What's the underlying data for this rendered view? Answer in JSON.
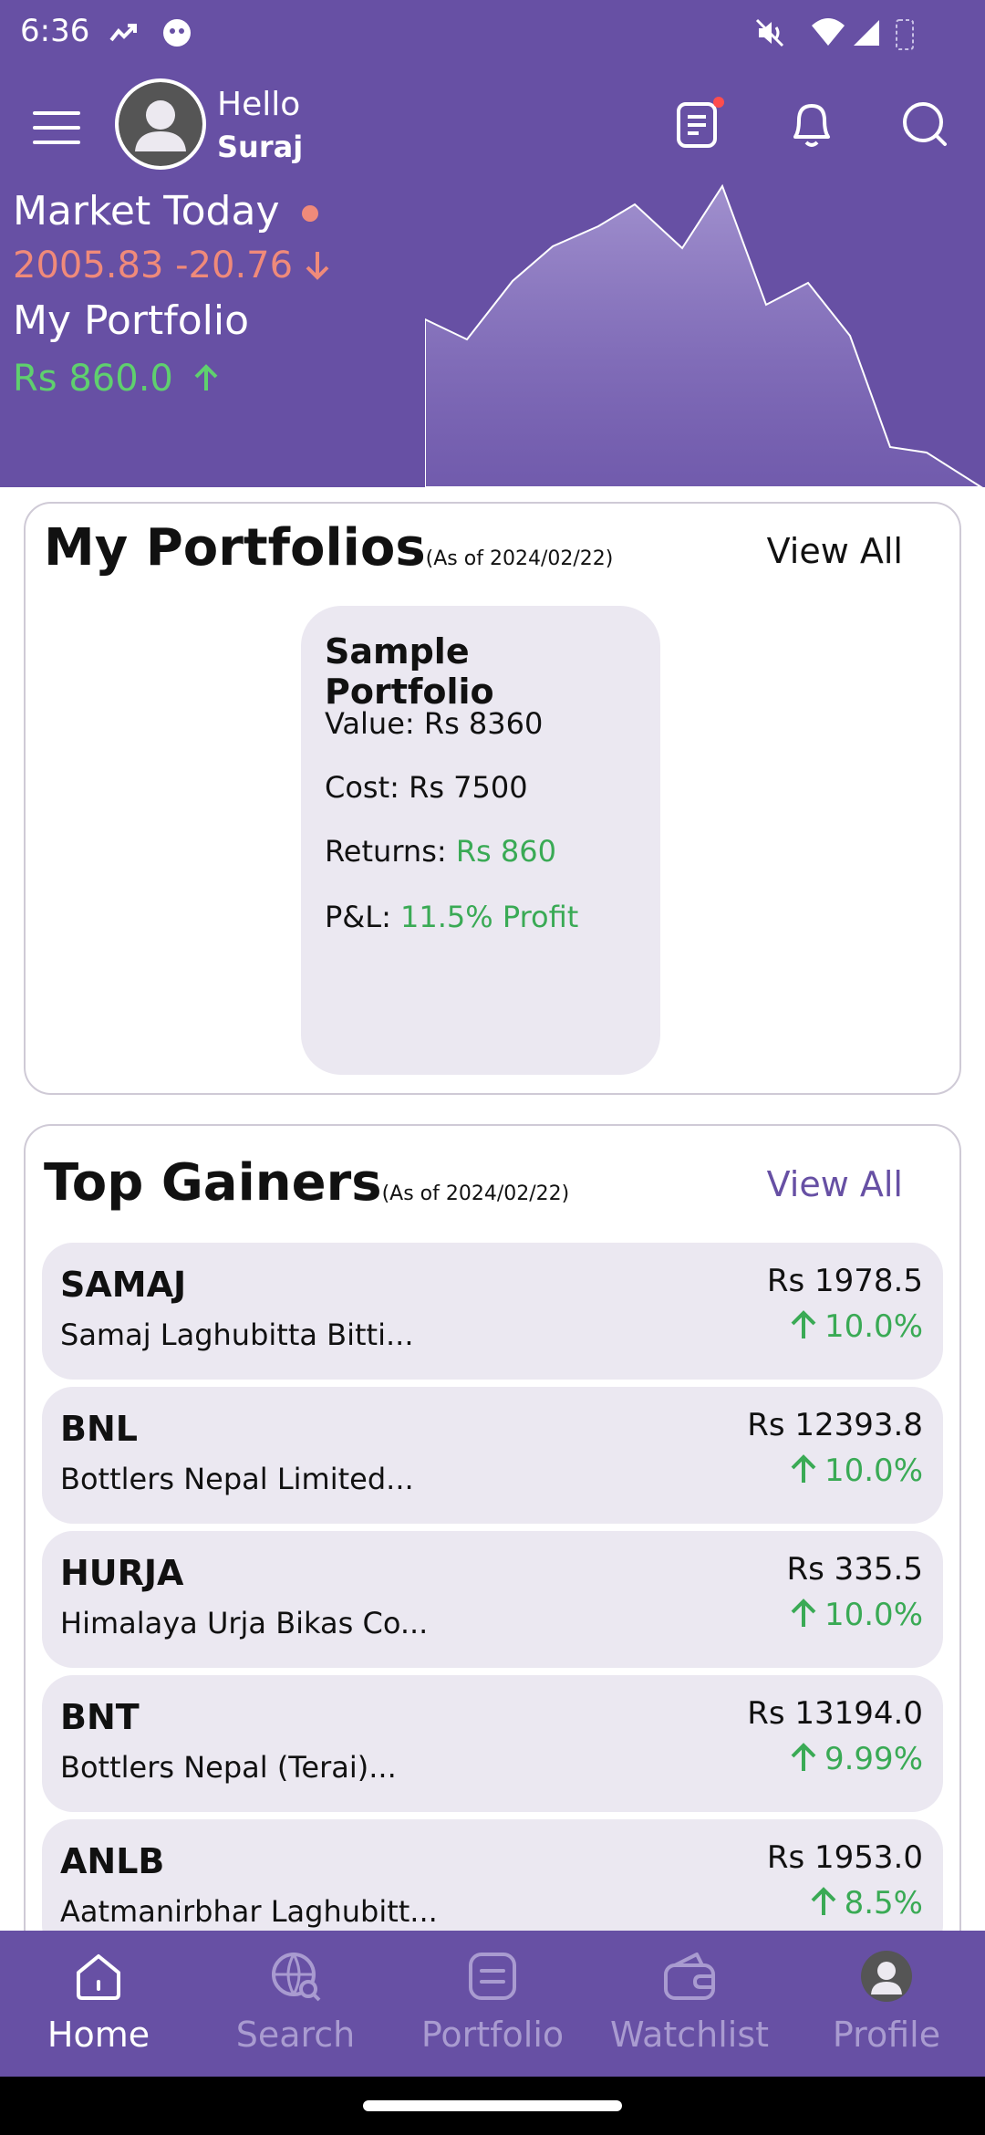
{
  "status": {
    "time": "6:36"
  },
  "user": {
    "greeting": "Hello",
    "name": "Suraj"
  },
  "market": {
    "title": "Market Today",
    "value_change": "2005.83 -20.76",
    "portfolio_label": "My Portfolio",
    "portfolio_value": "Rs 860.0"
  },
  "portfolios": {
    "title": "My Portfolios",
    "as_of": "(As of 2024/02/22)",
    "view_all": "View All",
    "card": {
      "name": "Sample Portfolio",
      "value_label": "Value:",
      "value": "Rs  8360",
      "cost_label": "Cost:",
      "cost": "Rs  7500",
      "returns_label": "Returns:",
      "returns": "Rs 860",
      "pl_label": "P&L:",
      "pl": "11.5% Profit"
    }
  },
  "gainers": {
    "title": "Top Gainers",
    "as_of": "(As of 2024/02/22)",
    "view_all": "View All",
    "items": [
      {
        "symbol": "SAMAJ",
        "name": "Samaj Laghubitta Bitti...",
        "price": "Rs 1978.5",
        "change": "10.0%"
      },
      {
        "symbol": "BNL",
        "name": "Bottlers Nepal Limited...",
        "price": "Rs 12393.8",
        "change": "10.0%"
      },
      {
        "symbol": "HURJA",
        "name": "Himalaya Urja Bikas Co...",
        "price": "Rs 335.5",
        "change": "10.0%"
      },
      {
        "symbol": "BNT",
        "name": "Bottlers Nepal (Terai)...",
        "price": "Rs 13194.0",
        "change": "9.99%"
      },
      {
        "symbol": "ANLB",
        "name": "Aatmanirbhar Laghubitt...",
        "price": "Rs 1953.0",
        "change": "8.5%"
      }
    ]
  },
  "nav": {
    "items": [
      {
        "label": "Home",
        "icon": "home-icon",
        "active": true
      },
      {
        "label": "Search",
        "icon": "globe-search-icon",
        "active": false
      },
      {
        "label": "Portfolio",
        "icon": "portfolio-icon",
        "active": false
      },
      {
        "label": "Watchlist",
        "icon": "wallet-icon",
        "active": false
      },
      {
        "label": "Profile",
        "icon": "profile-avatar-icon",
        "active": false
      }
    ]
  },
  "colors": {
    "primary": "#6750a4",
    "card_bg": "#ebe8f1",
    "positive": "#3aaa55",
    "negative": "#f08a7a",
    "nav_inactive": "#a99bd0"
  }
}
